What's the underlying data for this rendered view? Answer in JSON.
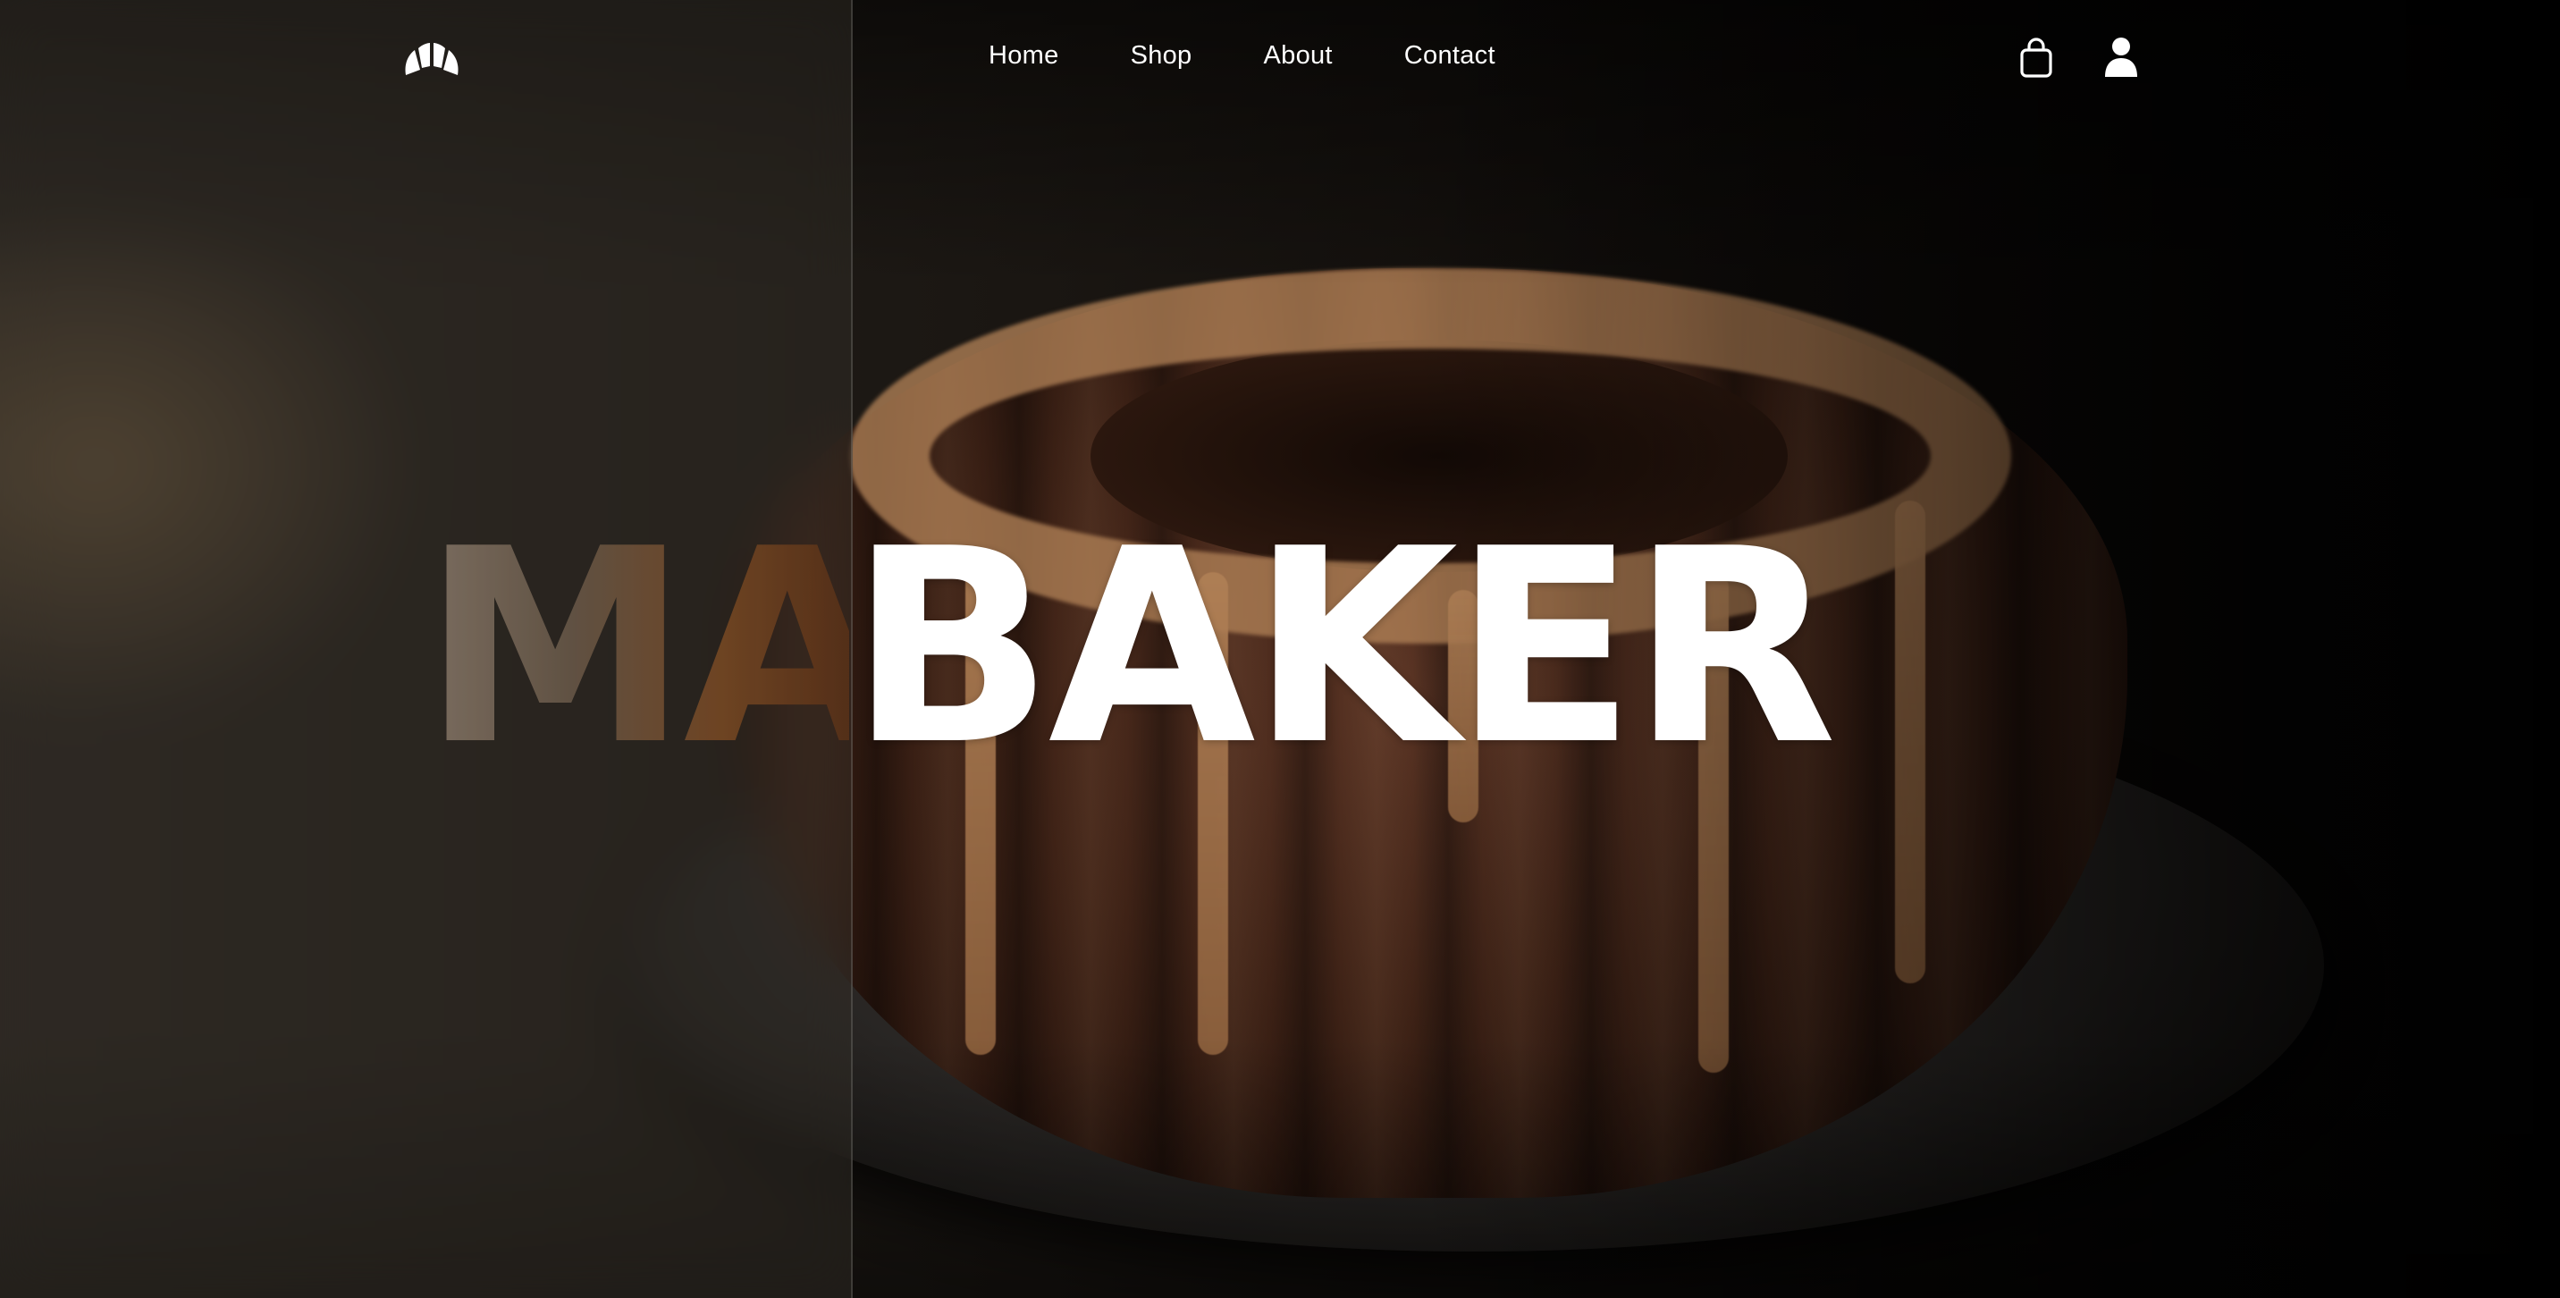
{
  "nav": {
    "links": [
      {
        "label": "Home"
      },
      {
        "label": "Shop"
      },
      {
        "label": "About"
      },
      {
        "label": "Contact"
      }
    ],
    "logo_icon": "croissant-icon",
    "cart_icon": "shopping-bag-icon",
    "user_icon": "user-icon"
  },
  "hero": {
    "title_faded": "MA",
    "title_solid": "BAKER",
    "background": "glazed bundt cake on dark plate"
  },
  "colors": {
    "text": "#ffffff",
    "panel_tint": "#342e28",
    "glaze": "#b08056",
    "cake": "#3e2216"
  }
}
